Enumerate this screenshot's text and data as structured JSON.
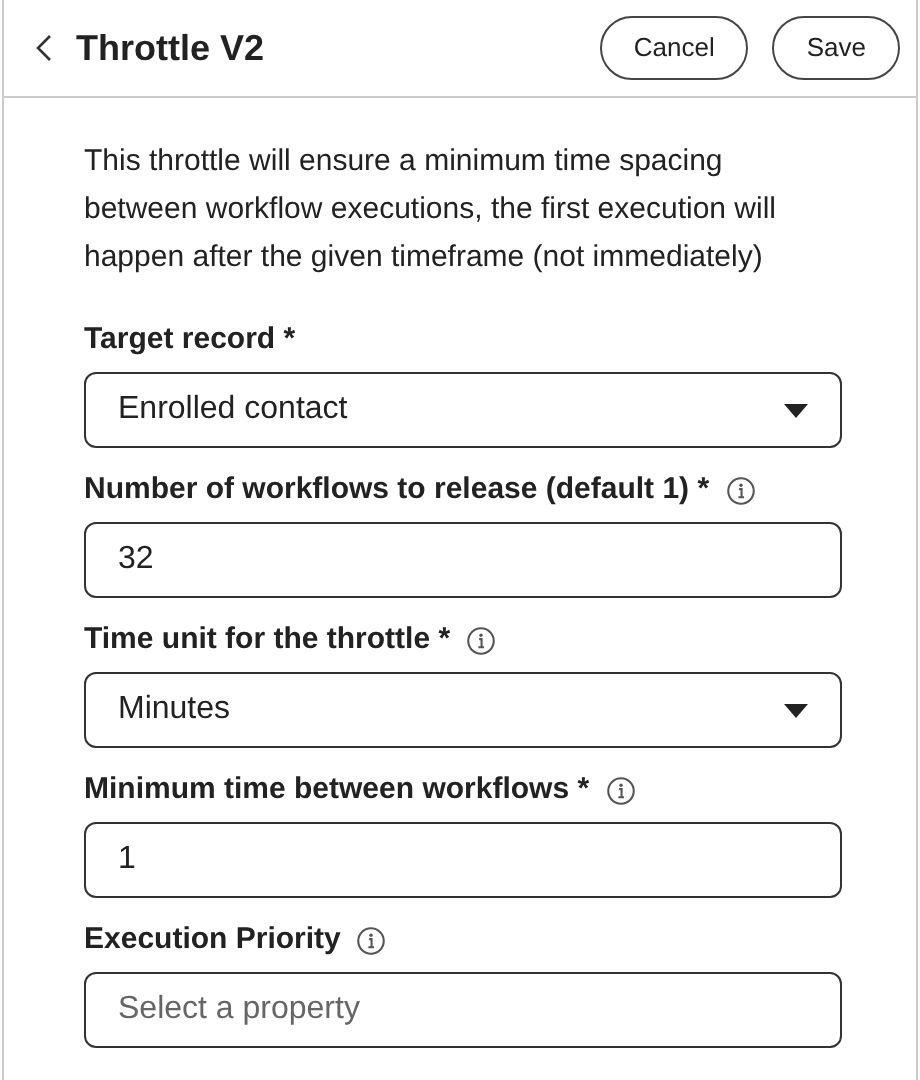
{
  "header": {
    "title": "Throttle V2",
    "buttons": [
      "Cancel",
      "Save"
    ]
  },
  "description": "This throttle will ensure a minimum time spacing between workflow executions, the first execution will happen after the given timeframe (not immediately)",
  "fields": [
    {
      "label": "Target record *",
      "info": false,
      "kind": "select",
      "value": "Enrolled contact"
    },
    {
      "label": "Number of workflows to release (default 1) *",
      "info": true,
      "kind": "input",
      "value": "32"
    },
    {
      "label": "Time unit for the throttle *",
      "info": true,
      "kind": "select",
      "value": "Minutes"
    },
    {
      "label": "Minimum time between workflows *",
      "info": true,
      "kind": "input",
      "value": "1"
    },
    {
      "label": "Execution Priority",
      "info": true,
      "kind": "input",
      "placeholder": "Select a property"
    }
  ]
}
